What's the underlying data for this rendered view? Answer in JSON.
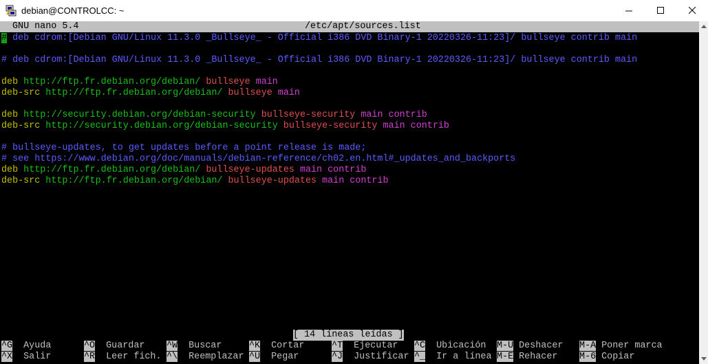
{
  "window": {
    "title": "debian@CONTROLCC: ~",
    "controls": {
      "minimize": "—",
      "maximize": "☐",
      "close": "✕"
    }
  },
  "nano": {
    "version": "GNU nano 5.4",
    "filename": "/etc/apt/sources.list",
    "status": "[ 14 líneas leídas ]"
  },
  "lines": [
    {
      "cursor": "#",
      "segs": [
        {
          "t": " deb cdrom:[Debian GNU/Linux 11.3.0 _Bullseye_ - Official i386 DVD Binary-1 20220326-11:23]/ bullseye contrib main",
          "c": "comment"
        }
      ]
    },
    {
      "segs": []
    },
    {
      "segs": [
        {
          "t": "# deb cdrom:[Debian GNU/Linux 11.3.0 _Bullseye_ - Official i386 DVD Binary-1 20220326-11:23]/ bullseye contrib main",
          "c": "comment"
        }
      ]
    },
    {
      "segs": []
    },
    {
      "segs": [
        {
          "t": "deb ",
          "c": "kw"
        },
        {
          "t": "http://ftp.fr.debian.org/debian/ ",
          "c": "url"
        },
        {
          "t": "bullseye ",
          "c": "suite"
        },
        {
          "t": "main",
          "c": "comp"
        }
      ]
    },
    {
      "segs": [
        {
          "t": "deb-src ",
          "c": "kw"
        },
        {
          "t": "http://ftp.fr.debian.org/debian/ ",
          "c": "url"
        },
        {
          "t": "bullseye ",
          "c": "suite"
        },
        {
          "t": "main",
          "c": "comp"
        }
      ]
    },
    {
      "segs": []
    },
    {
      "segs": [
        {
          "t": "deb ",
          "c": "kw"
        },
        {
          "t": "http://security.debian.org/debian-security ",
          "c": "url"
        },
        {
          "t": "bullseye-security ",
          "c": "suite"
        },
        {
          "t": "main contrib",
          "c": "comp"
        }
      ]
    },
    {
      "segs": [
        {
          "t": "deb-src ",
          "c": "kw"
        },
        {
          "t": "http://security.debian.org/debian-security ",
          "c": "url"
        },
        {
          "t": "bullseye-security ",
          "c": "suite"
        },
        {
          "t": "main contrib",
          "c": "comp"
        }
      ]
    },
    {
      "segs": []
    },
    {
      "segs": [
        {
          "t": "# bullseye-updates, to get updates before a point release is made;",
          "c": "comment"
        }
      ]
    },
    {
      "segs": [
        {
          "t": "# see https://www.debian.org/doc/manuals/debian-reference/ch02.en.html#_updates_and_backports",
          "c": "comment"
        }
      ]
    },
    {
      "segs": [
        {
          "t": "deb ",
          "c": "kw"
        },
        {
          "t": "http://ftp.fr.debian.org/debian/ ",
          "c": "url"
        },
        {
          "t": "bullseye-updates ",
          "c": "suite"
        },
        {
          "t": "main contrib",
          "c": "comp"
        }
      ]
    },
    {
      "segs": [
        {
          "t": "deb-src ",
          "c": "kw"
        },
        {
          "t": "http://ftp.fr.debian.org/debian/ ",
          "c": "url"
        },
        {
          "t": "bullseye-updates ",
          "c": "suite"
        },
        {
          "t": "main contrib",
          "c": "comp"
        }
      ]
    }
  ],
  "shortcuts": [
    [
      {
        "key": "^G",
        "label": "Ayuda"
      },
      {
        "key": "^O",
        "label": "Guardar"
      },
      {
        "key": "^W",
        "label": "Buscar"
      },
      {
        "key": "^K",
        "label": "Cortar"
      },
      {
        "key": "^T",
        "label": "Ejecutar"
      },
      {
        "key": "^C",
        "label": "Ubicación"
      },
      {
        "key": "M-U",
        "label": "Deshacer"
      },
      {
        "key": "M-A",
        "label": "Poner marca"
      }
    ],
    [
      {
        "key": "^X",
        "label": "Salir"
      },
      {
        "key": "^R",
        "label": "Leer fich."
      },
      {
        "key": "^\\",
        "label": "Reemplazar"
      },
      {
        "key": "^U",
        "label": "Pegar"
      },
      {
        "key": "^J",
        "label": "Justificar"
      },
      {
        "key": "^_",
        "label": "Ir a línea"
      },
      {
        "key": "M-E",
        "label": "Rehacer"
      },
      {
        "key": "M-6",
        "label": "Copiar"
      }
    ]
  ],
  "colors": {
    "header_bg": "#c0c0c0",
    "cursor": "#13a10e",
    "comment": "#5c5cff",
    "keyword": "#c0c000",
    "url": "#18c018",
    "suite": "#e05050",
    "component": "#d040d0"
  },
  "icons": {
    "app": "putty-terminal-icon"
  }
}
